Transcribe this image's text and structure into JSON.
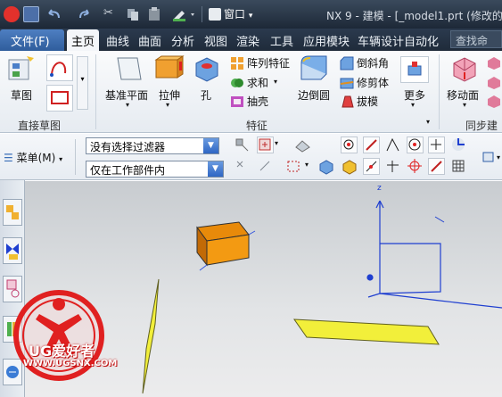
{
  "titlebar": {
    "window_menu_label": "窗口",
    "title": "NX 9 - 建模 - [_model1.prt  (修改的)"
  },
  "menubar": {
    "file_label": "文件(F)",
    "tabs": [
      "主页",
      "曲线",
      "曲面",
      "分析",
      "视图",
      "渲染",
      "工具",
      "应用模块",
      "车辆设计自动化"
    ],
    "search_placeholder": "查找命令"
  },
  "ribbon": {
    "sketch_label": "草图",
    "direct_sketch_group": "直接草图",
    "datum_plane_label": "基准平面",
    "extrude_label": "拉伸",
    "hole_label": "孔",
    "pattern_feature_label": "阵列特征",
    "unite_label": "求和",
    "shell_label": "抽壳",
    "edge_blend_label": "边倒圆",
    "chamfer_label": "倒斜角",
    "trim_body_label": "修剪体",
    "draft_label": "拔模",
    "more_label": "更多",
    "feature_group": "特征",
    "move_face_label": "移动面",
    "sync_modeling_group": "同步建模"
  },
  "toolbar": {
    "menu_label": "菜单(M)",
    "filter_value": "没有选择过滤器",
    "scope_value": "仅在工作部件内"
  },
  "watermark": {
    "brand": "UG爱好者",
    "url": "WWW.UGSNX.COM"
  },
  "colors": {
    "titlebar_bg": "#243142",
    "file_tab_bg": "#3f6fb0",
    "block_face": "#f39a12",
    "plane_fill": "#f2ef3a",
    "axis_blue": "#1f3fd0",
    "watermark_red": "#e02020"
  }
}
